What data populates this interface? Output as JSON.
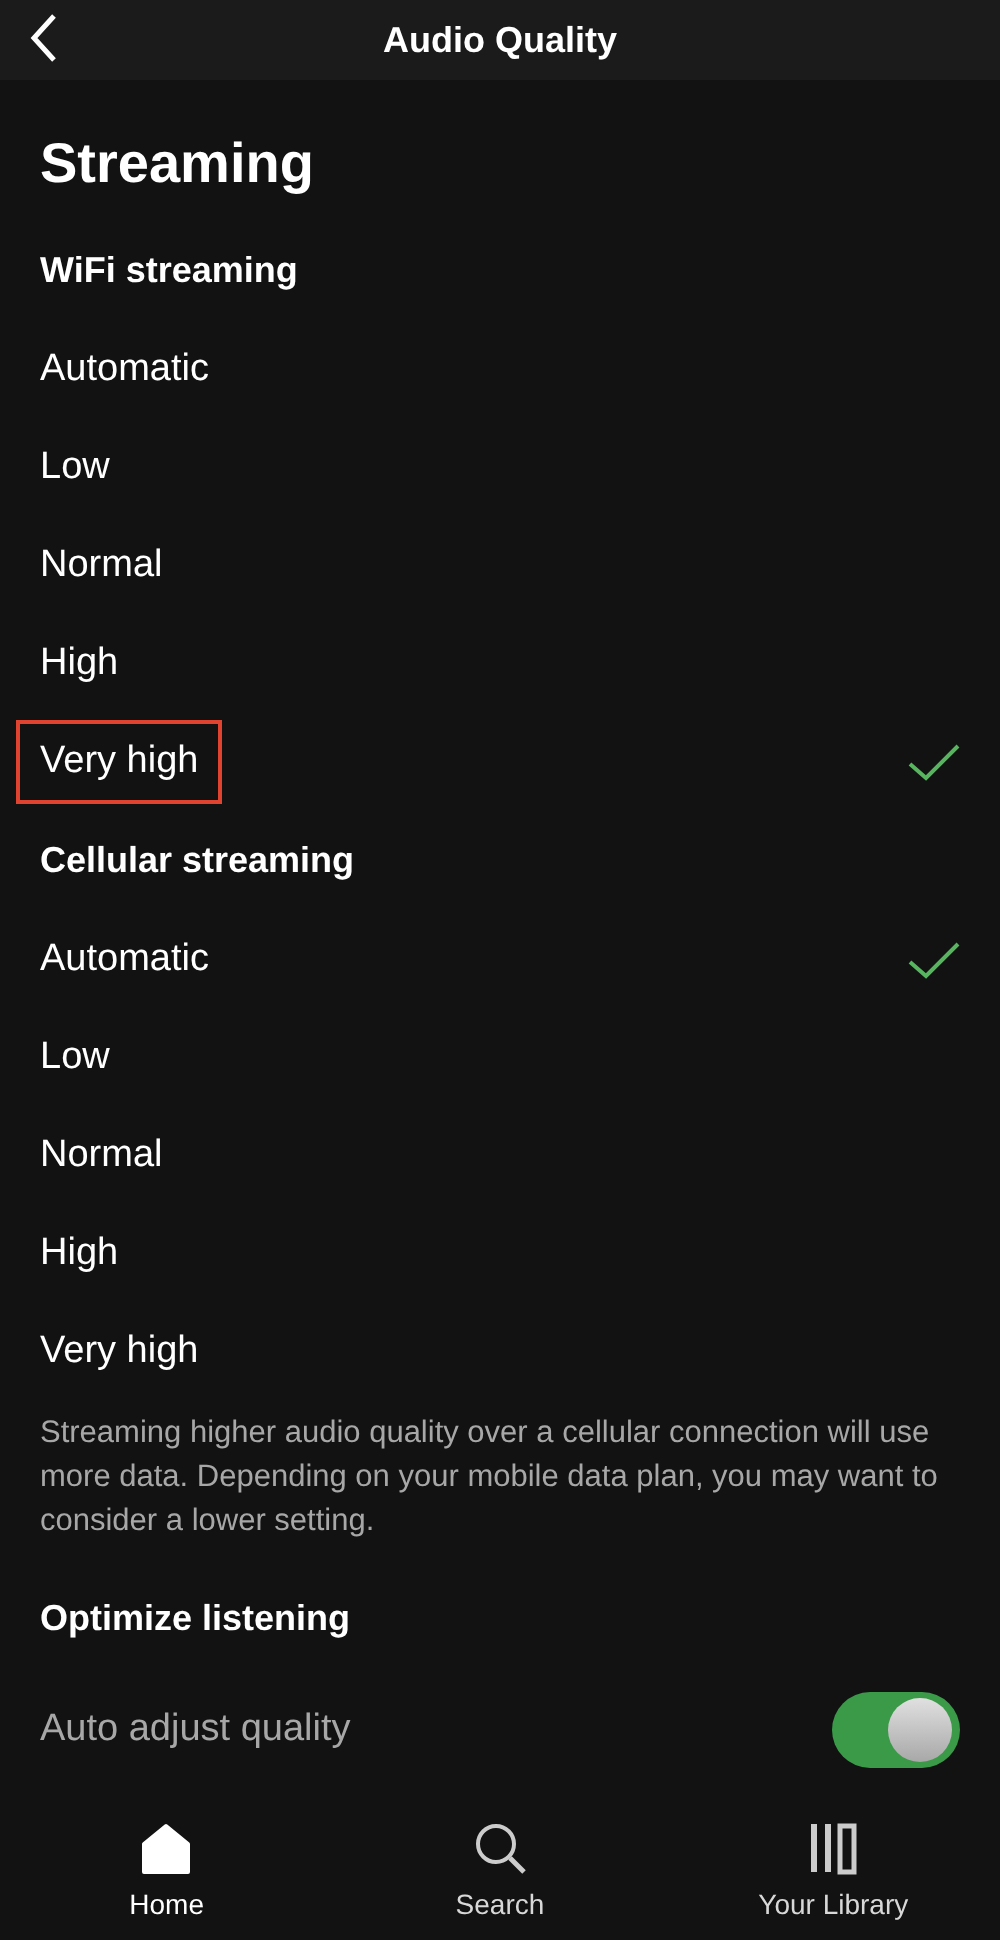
{
  "header": {
    "title": "Audio Quality"
  },
  "page_title": "Streaming",
  "sections": [
    {
      "title": "WiFi streaming",
      "options": [
        {
          "label": "Automatic",
          "selected": false,
          "highlighted": false
        },
        {
          "label": "Low",
          "selected": false,
          "highlighted": false
        },
        {
          "label": "Normal",
          "selected": false,
          "highlighted": false
        },
        {
          "label": "High",
          "selected": false,
          "highlighted": false
        },
        {
          "label": "Very high",
          "selected": true,
          "highlighted": true
        }
      ]
    },
    {
      "title": "Cellular streaming",
      "options": [
        {
          "label": "Automatic",
          "selected": true,
          "highlighted": false
        },
        {
          "label": "Low",
          "selected": false,
          "highlighted": false
        },
        {
          "label": "Normal",
          "selected": false,
          "highlighted": false
        },
        {
          "label": "High",
          "selected": false,
          "highlighted": false
        },
        {
          "label": "Very high",
          "selected": false,
          "highlighted": false
        }
      ],
      "note": "Streaming higher audio quality over a cellular connection will use more data. Depending on your mobile data plan, you may want to consider a lower setting."
    }
  ],
  "optimize": {
    "title": "Optimize listening",
    "setting": {
      "label": "Auto adjust quality",
      "on": true
    }
  },
  "nav": [
    {
      "kind": "home",
      "label": "Home",
      "selected": true
    },
    {
      "kind": "search",
      "label": "Search",
      "selected": false
    },
    {
      "kind": "library",
      "label": "Your Library",
      "selected": false
    }
  ]
}
